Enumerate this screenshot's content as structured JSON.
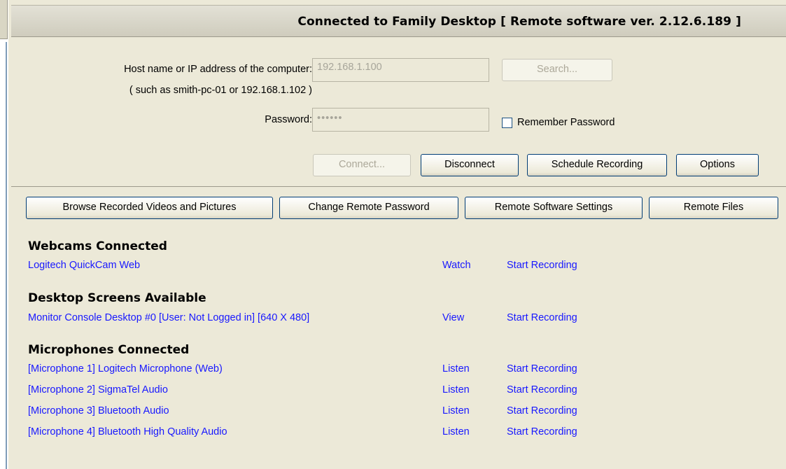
{
  "header": {
    "title": "Connected to Family Desktop [ Remote software ver. 2.12.6.189 ]"
  },
  "connection": {
    "host_label": "Host name or IP address of the computer:",
    "host_hint": "( such as smith-pc-01 or 192.168.1.102 )",
    "host_value": "192.168.1.100",
    "search_button": "Search...",
    "password_label": "Password:",
    "password_value": "••••••",
    "remember_label": "Remember Password",
    "remember_checked": false,
    "connect_button": "Connect...",
    "disconnect_button": "Disconnect",
    "schedule_button": "Schedule Recording",
    "options_button": "Options"
  },
  "toolbar": {
    "browse_button": "Browse Recorded Videos and Pictures",
    "change_password_button": "Change Remote Password",
    "settings_button": "Remote Software Settings",
    "files_button": "Remote Files"
  },
  "webcams": {
    "title": "Webcams Connected",
    "items": [
      {
        "name": "Logitech QuickCam Web",
        "action": "Watch",
        "record": "Start Recording"
      }
    ]
  },
  "screens": {
    "title": "Desktop Screens Available",
    "items": [
      {
        "name": "Monitor Console Desktop #0 [User: Not Logged in] [640 X 480]",
        "action": "View",
        "record": "Start Recording"
      }
    ]
  },
  "microphones": {
    "title": "Microphones Connected",
    "items": [
      {
        "name": "[Microphone 1] Logitech Microphone (Web)",
        "action": "Listen",
        "record": "Start Recording"
      },
      {
        "name": "[Microphone 2] SigmaTel Audio",
        "action": "Listen",
        "record": "Start Recording"
      },
      {
        "name": "[Microphone 3] Bluetooth Audio",
        "action": "Listen",
        "record": "Start Recording"
      },
      {
        "name": "[Microphone 4] Bluetooth High Quality Audio",
        "action": "Listen",
        "record": "Start Recording"
      }
    ]
  },
  "colors": {
    "background": "#ece9d8",
    "link": "#1818ff",
    "button_border": "#003c74"
  }
}
